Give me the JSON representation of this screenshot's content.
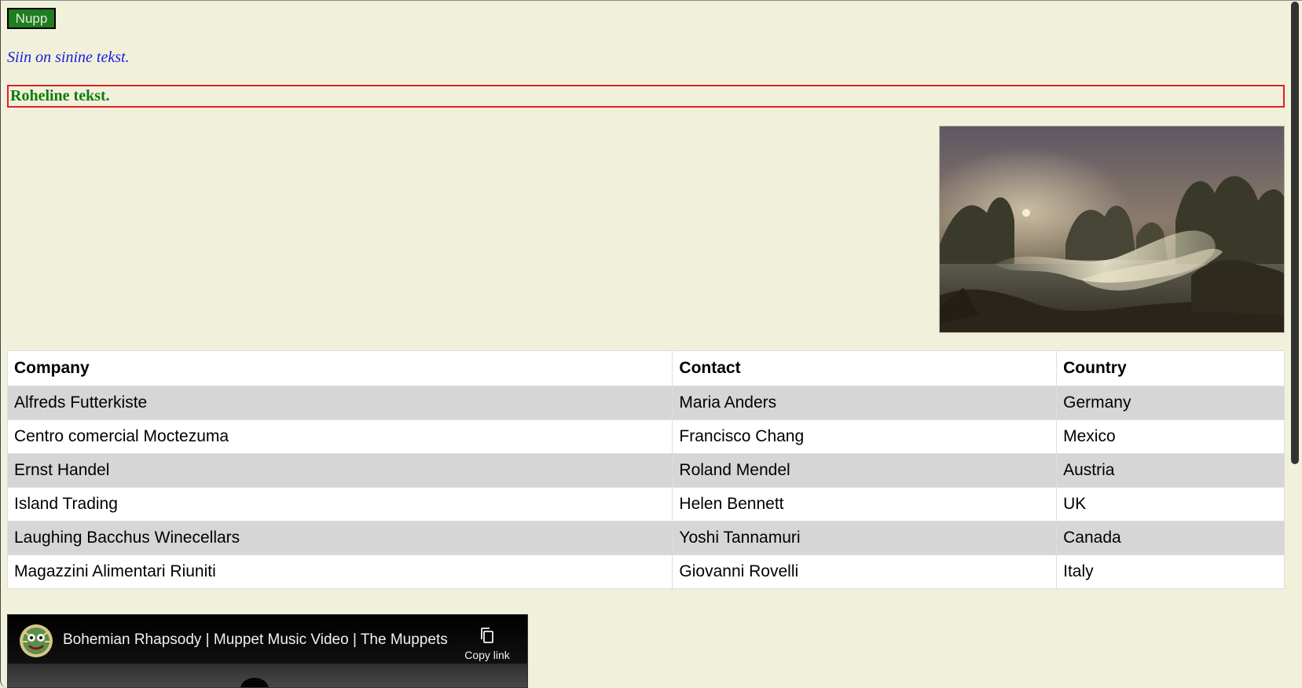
{
  "button": {
    "label": "Nupp"
  },
  "blue_text": "Siin on sinine tekst.",
  "green_text": "Roheline tekst.",
  "table": {
    "headers": [
      "Company",
      "Contact",
      "Country"
    ],
    "rows": [
      [
        "Alfreds Futterkiste",
        "Maria Anders",
        "Germany"
      ],
      [
        "Centro comercial Moctezuma",
        "Francisco Chang",
        "Mexico"
      ],
      [
        "Ernst Handel",
        "Roland Mendel",
        "Austria"
      ],
      [
        "Island Trading",
        "Helen Bennett",
        "UK"
      ],
      [
        "Laughing Bacchus Winecellars",
        "Yoshi Tannamuri",
        "Canada"
      ],
      [
        "Magazzini Alimentari Riuniti",
        "Giovanni Rovelli",
        "Italy"
      ]
    ]
  },
  "video": {
    "title": "Bohemian Rhapsody | Muppet Music Video | The Muppets",
    "copy_link_label": "Copy link",
    "channel_icon": "muppets-channel-avatar"
  },
  "colors": {
    "page_background": "#f1f1db",
    "button_background": "#1f7c1f",
    "blue_text": "#1a1ae0",
    "green_text": "#107a10",
    "green_box_border": "#e0202a",
    "table_stripe": "#d6d6d6"
  }
}
